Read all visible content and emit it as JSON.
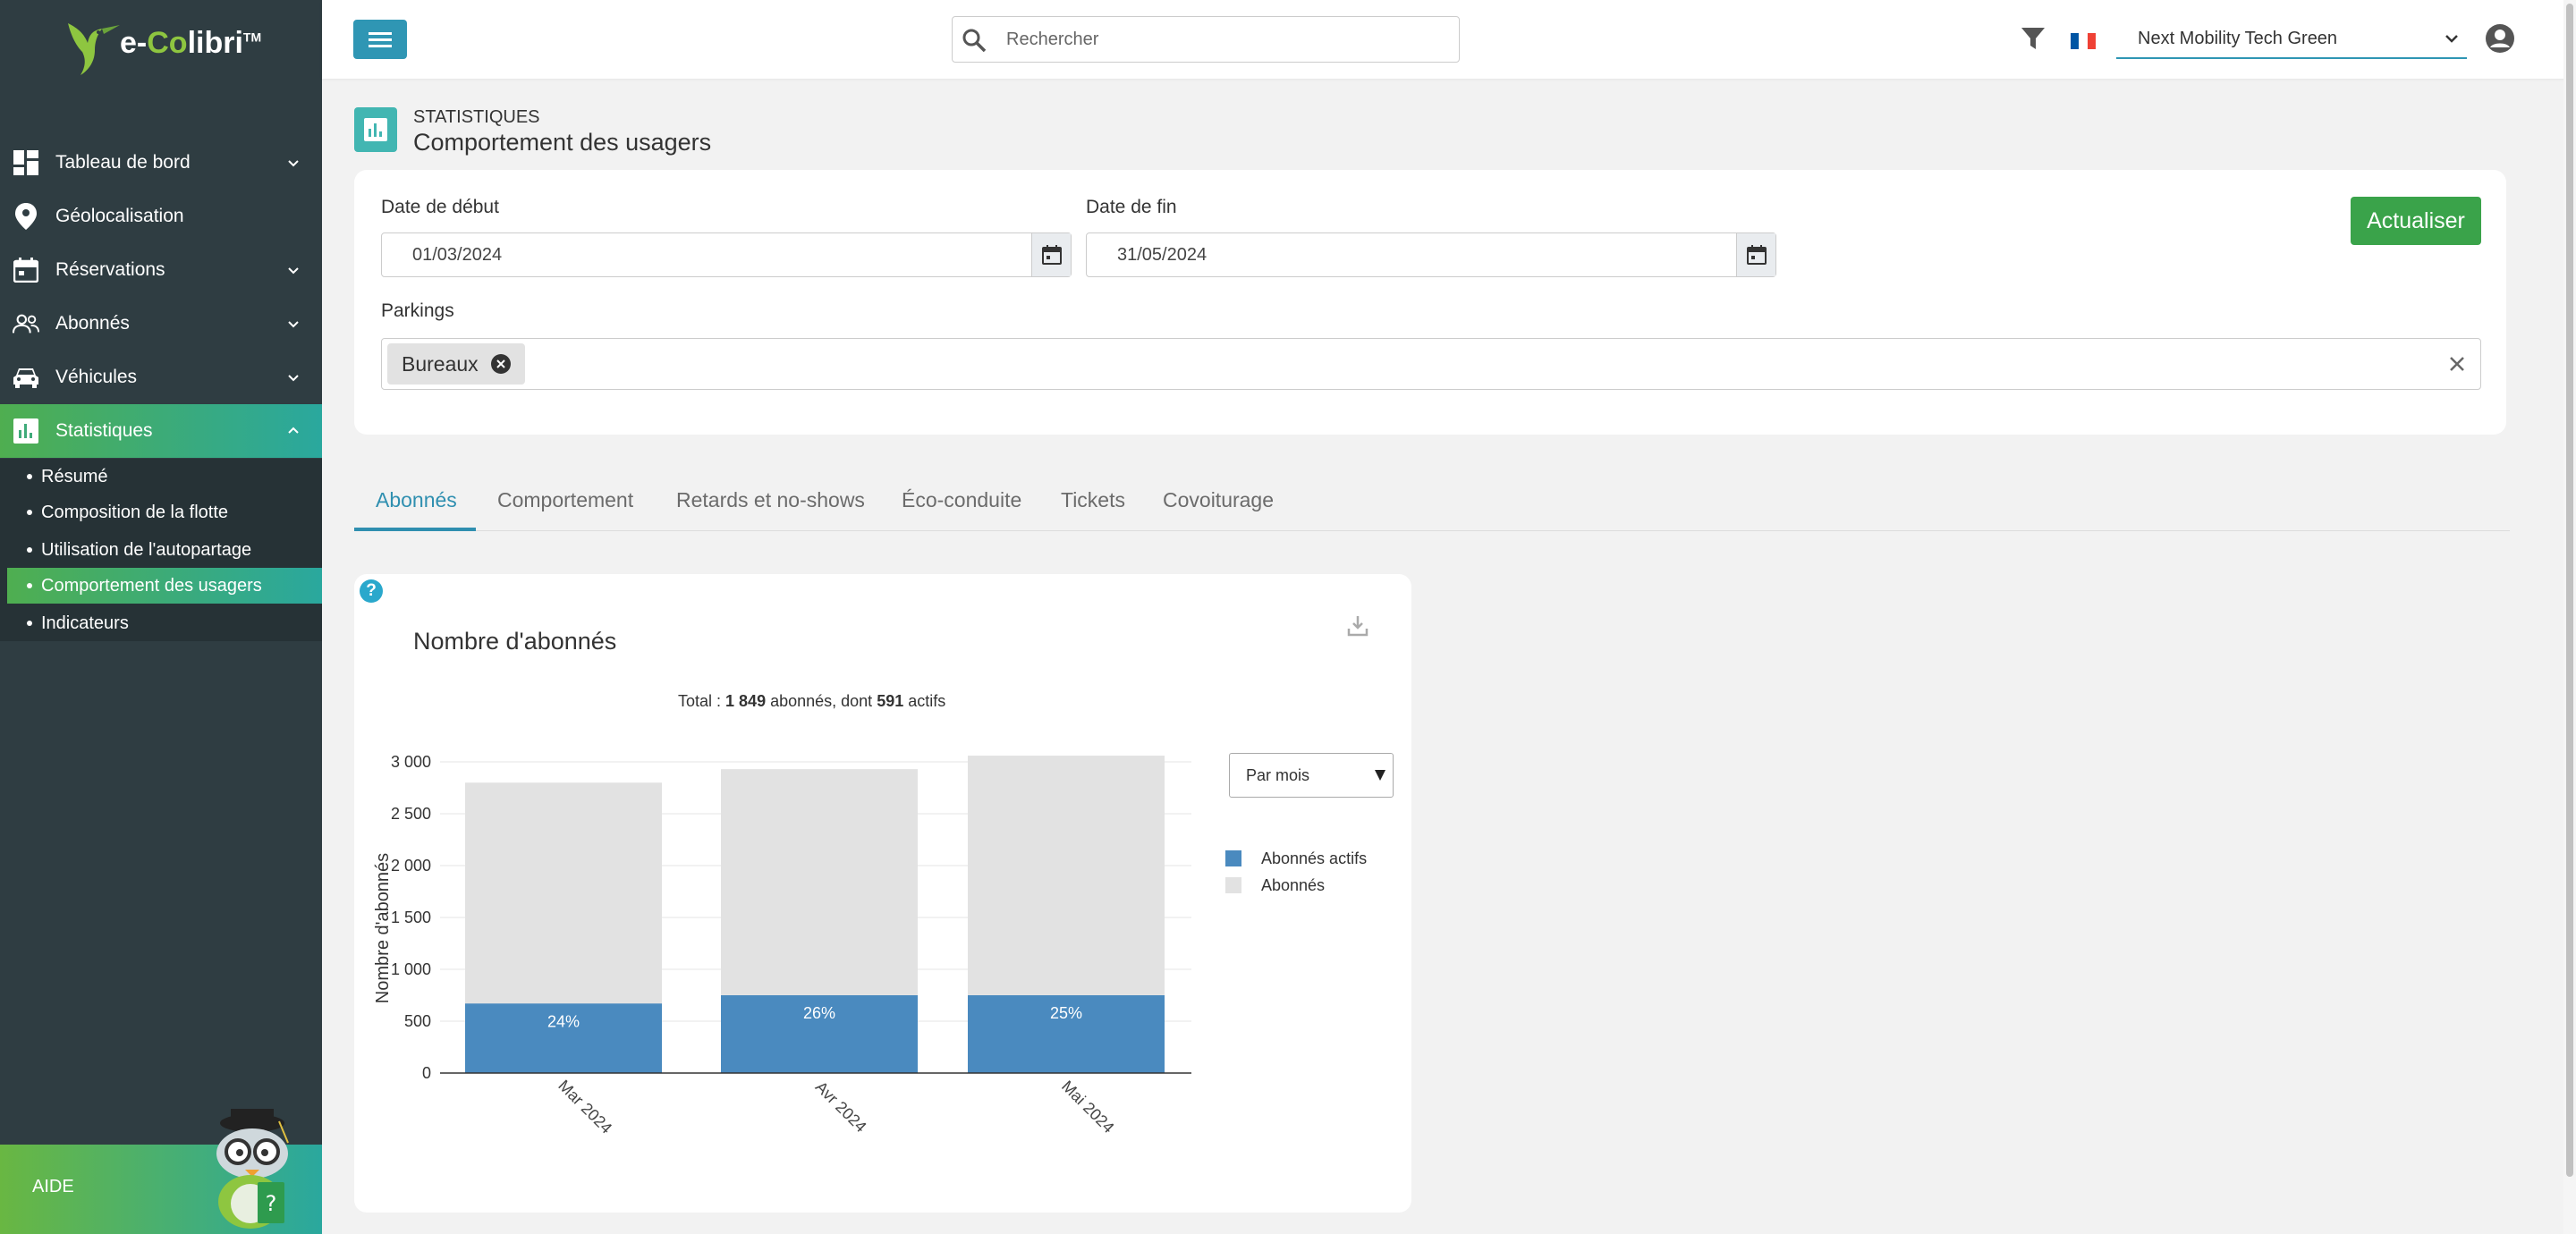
{
  "brand": {
    "name_prefix": "e-",
    "name_co": "Co",
    "name_suffix": "libri",
    "trademark": "TM"
  },
  "sidebar": {
    "items": [
      {
        "label": "Tableau de bord",
        "icon": "dashboard-icon",
        "chevron": "down"
      },
      {
        "label": "Géolocalisation",
        "icon": "map-pin-icon",
        "chevron": ""
      },
      {
        "label": "Réservations",
        "icon": "calendar-icon",
        "chevron": "down"
      },
      {
        "label": "Abonnés",
        "icon": "users-icon",
        "chevron": "down"
      },
      {
        "label": "Véhicules",
        "icon": "car-icon",
        "chevron": "down"
      },
      {
        "label": "Statistiques",
        "icon": "bar-chart-icon",
        "chevron": "up"
      }
    ],
    "subitems": [
      {
        "label": "Résumé"
      },
      {
        "label": "Composition de la flotte"
      },
      {
        "label": "Utilisation de l'autopartage"
      },
      {
        "label": "Comportement des usagers"
      },
      {
        "label": "Indicateurs"
      }
    ],
    "help_label": "AIDE"
  },
  "topbar": {
    "search_placeholder": "Rechercher",
    "organization": "Next Mobility Tech Green",
    "flag_colors": [
      "#0055a4",
      "#ffffff",
      "#ef4135"
    ]
  },
  "page": {
    "section": "STATISTIQUES",
    "title": "Comportement des usagers"
  },
  "filters": {
    "start_label": "Date de début",
    "start_value": "01/03/2024",
    "end_label": "Date de fin",
    "end_value": "31/05/2024",
    "refresh_label": "Actualiser",
    "parkings_label": "Parkings",
    "parkings_selected": [
      "Bureaux"
    ]
  },
  "tabs": [
    {
      "label": "Abonnés",
      "active": true
    },
    {
      "label": "Comportement",
      "active": false
    },
    {
      "label": "Retards et no-shows",
      "active": false
    },
    {
      "label": "Éco-conduite",
      "active": false
    },
    {
      "label": "Tickets",
      "active": false
    },
    {
      "label": "Covoiturage",
      "active": false
    }
  ],
  "chart_panel": {
    "title": "Nombre d'abonnés",
    "total_prefix": "Total : ",
    "total_subscribers": "1 849",
    "total_middle": " abonnés, dont ",
    "total_active": "591",
    "total_suffix": " actifs",
    "period_option": "Par mois"
  },
  "chart_data": {
    "type": "bar",
    "stacked": true,
    "categories": [
      "Mar 2024",
      "Avr 2024",
      "Mai 2024"
    ],
    "series": [
      {
        "name": "Abonnés actifs",
        "color": "#4a8abf",
        "values": [
          670,
          750,
          750
        ],
        "labels": [
          "24%",
          "26%",
          "25%"
        ]
      },
      {
        "name": "Abonnés",
        "color": "#e2e2e2",
        "values": [
          2800,
          2930,
          3060
        ]
      }
    ],
    "ylabel": "Nombre d'abonnés",
    "ylim": [
      0,
      3000
    ],
    "yticks": [
      0,
      500,
      1000,
      1500,
      2000,
      2500,
      3000
    ],
    "ytick_labels": [
      "0",
      "500",
      "1 000",
      "1 500",
      "2 000",
      "2 500",
      "3 000"
    ],
    "grid": true,
    "legend": "right"
  },
  "colors": {
    "accent": "#2f96b4",
    "success": "#3aa34a",
    "sidebar_bg": "#2f3d42"
  }
}
